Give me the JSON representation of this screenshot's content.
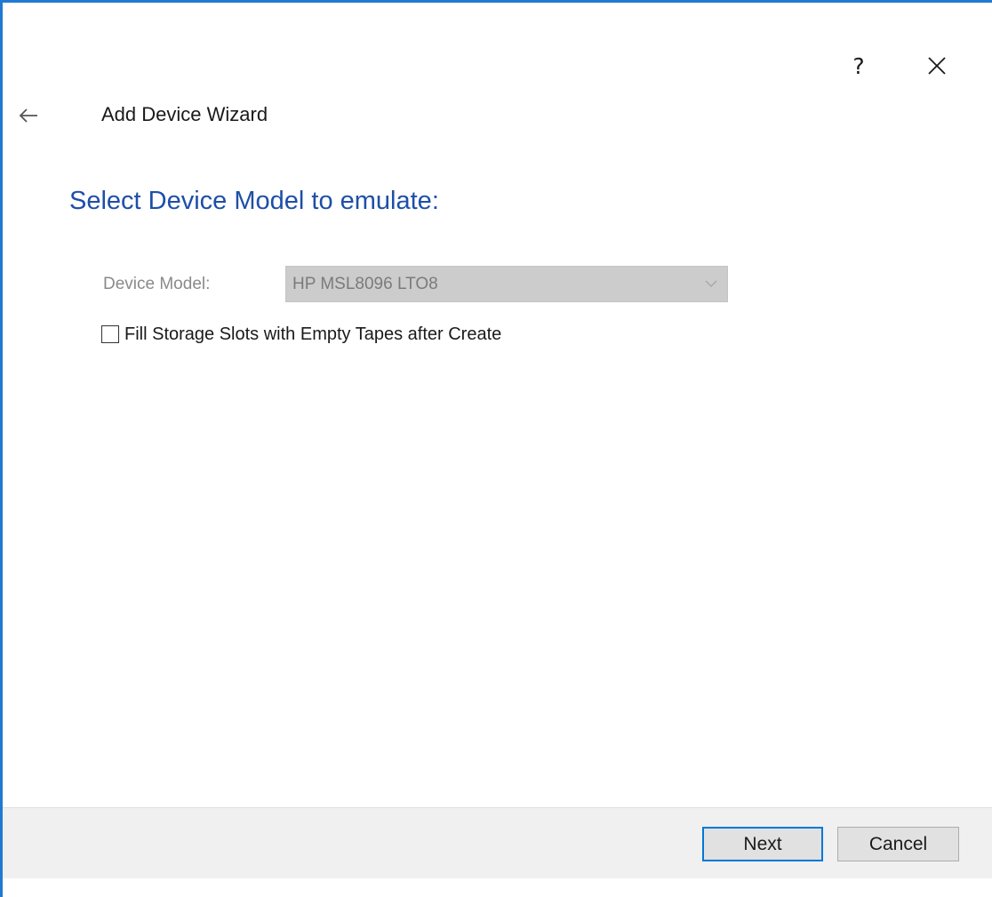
{
  "titlebar": {
    "help_label": "?"
  },
  "header": {
    "wizard_title": "Add Device Wizard"
  },
  "main": {
    "heading": "Select Device Model to emulate:",
    "device_model_label": "Device Model:",
    "device_model_value": "HP MSL8096 LTO8",
    "fill_slots_label": "Fill Storage Slots with Empty Tapes after Create",
    "fill_slots_checked": false
  },
  "footer": {
    "next_label": "Next",
    "cancel_label": "Cancel"
  },
  "icons": {
    "back": "back-arrow-icon",
    "close": "close-icon",
    "dropdown": "chevron-down-icon"
  },
  "colors": {
    "accent": "#1f7bd1",
    "heading": "#1e4fa8",
    "footer_bg": "#f0f0f0",
    "disabled_field": "#cccccc"
  }
}
